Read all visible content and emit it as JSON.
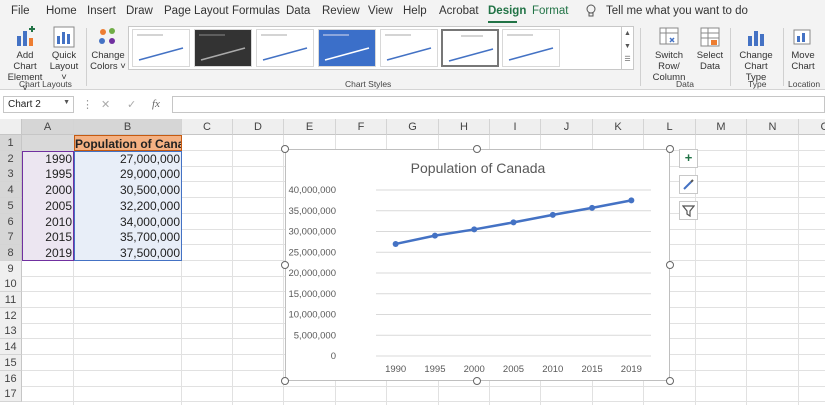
{
  "tabs": [
    "File",
    "Home",
    "Insert",
    "Draw",
    "Page Layout",
    "Formulas",
    "Data",
    "Review",
    "View",
    "Help",
    "Acrobat",
    "Design",
    "Format"
  ],
  "active_tab": "Design",
  "tell_me": "Tell me what you want to do",
  "ribbon": {
    "add_chart_element": [
      "Add Chart",
      "Element ˅"
    ],
    "quick_layout": [
      "Quick",
      "Layout ˅"
    ],
    "change_colors": [
      "Change",
      "Colors ˅"
    ],
    "chart_layouts_label": "Chart Layouts",
    "chart_styles_label": "Chart Styles",
    "switch_row_column": [
      "Switch Row/",
      "Column"
    ],
    "select_data": [
      "Select",
      "Data"
    ],
    "data_label": "Data",
    "change_chart_type": [
      "Change",
      "Chart Type"
    ],
    "type_label": "Type",
    "move_chart": [
      "Move",
      "Chart"
    ],
    "location_label": "Location"
  },
  "name_box": "Chart 2",
  "fx_label": "fx",
  "columns": [
    "A",
    "B",
    "C",
    "D",
    "E",
    "F",
    "G",
    "H",
    "I",
    "J",
    "K",
    "L",
    "M",
    "N",
    "C"
  ],
  "rows": [
    "1",
    "2",
    "3",
    "4",
    "5",
    "6",
    "7",
    "8",
    "9",
    "10",
    "11",
    "12",
    "13",
    "14",
    "15",
    "16",
    "17"
  ],
  "table": {
    "header": "Population of Canada",
    "years": [
      "1990",
      "1995",
      "2000",
      "2005",
      "2010",
      "2015",
      "2019"
    ],
    "values": [
      "27,000,000",
      "29,000,000",
      "30,500,000",
      "32,200,000",
      "34,000,000",
      "35,700,000",
      "37,500,000"
    ]
  },
  "chart_data": {
    "type": "line",
    "title": "Population of Canada",
    "categories": [
      "1990",
      "1995",
      "2000",
      "2005",
      "2010",
      "2015",
      "2019"
    ],
    "values": [
      27000000,
      29000000,
      30500000,
      32200000,
      34000000,
      35700000,
      37500000
    ],
    "ylim": [
      0,
      40000000
    ],
    "yticks": [
      "0",
      "5,000,000",
      "10,000,000",
      "15,000,000",
      "20,000,000",
      "25,000,000",
      "30,000,000",
      "35,000,000",
      "40,000,000"
    ],
    "grid": true,
    "line_color": "#4472c4"
  },
  "colors": {
    "accent": "#217346",
    "header_fill": "#f4b183",
    "data_fill": "#e8eef8",
    "year_fill": "#ece6f1"
  }
}
